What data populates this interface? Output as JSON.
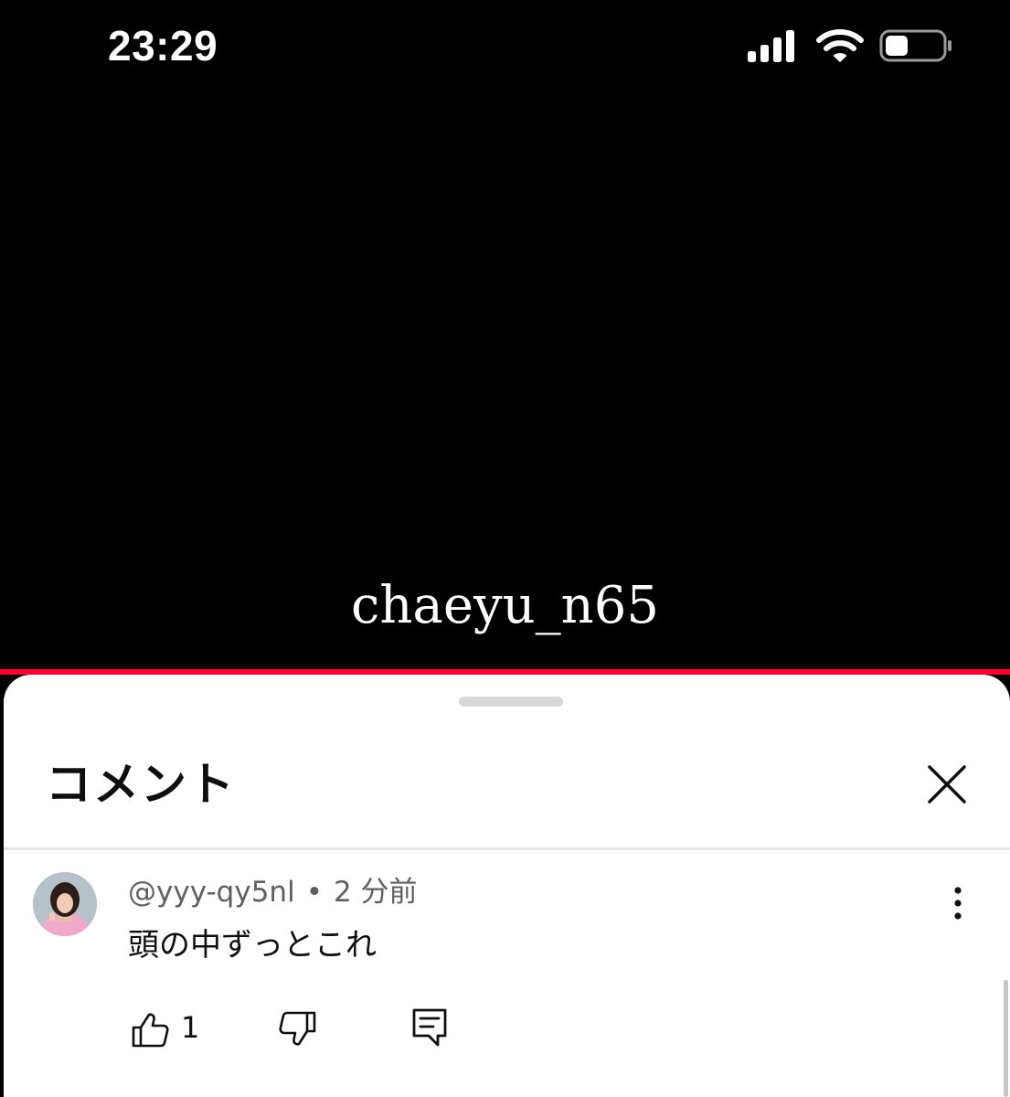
{
  "status_bar": {
    "time": "23:29",
    "icons": [
      "signal-icon",
      "wifi-icon",
      "battery-icon"
    ]
  },
  "video": {
    "watermark": "chaeyu_n65",
    "progress": 1.0,
    "progress_color": "#ff0033"
  },
  "comments_sheet": {
    "title": "コメント",
    "close_icon": "close-icon",
    "comments": [
      {
        "author": "@yyy-qy5nl",
        "separator": "•",
        "time_ago": "2 分前",
        "text": "頭の中ずっとこれ",
        "likes": "1",
        "icons": [
          "thumbs-up-icon",
          "thumbs-down-icon",
          "reply-icon",
          "more-vert-icon"
        ]
      }
    ]
  },
  "colors": {
    "accent": "#ff0033",
    "sheet_background": "#ffffff",
    "video_background": "#000000",
    "secondary_text": "#606060"
  }
}
